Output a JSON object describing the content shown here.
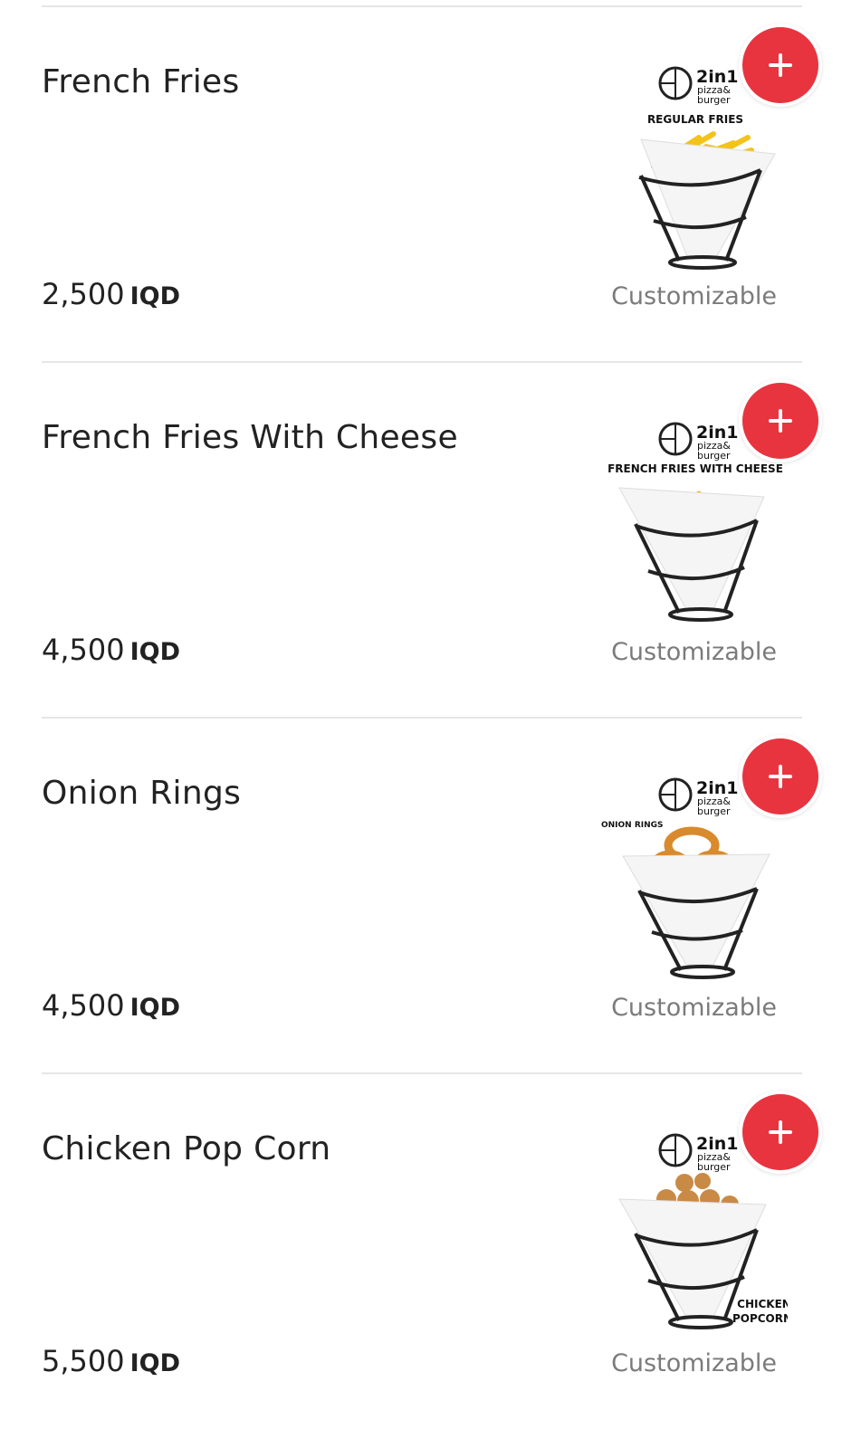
{
  "currency": "IQD",
  "customizable_label": "Customizable",
  "brand": {
    "logo_big": "2in1",
    "logo_small_1": "pizza&",
    "logo_small_2": "burger"
  },
  "accent_color": "#e8343f",
  "items": [
    {
      "name": "French Fries",
      "price": "2,500",
      "image_caption": "REGULAR FRIES",
      "image_kind": "fries"
    },
    {
      "name": "French Fries With Cheese",
      "price": "4,500",
      "image_caption": "FRENCH FRIES WITH CHEESE",
      "image_kind": "cheese-fries"
    },
    {
      "name": "Onion Rings",
      "price": "4,500",
      "image_caption": "ONION RINGS",
      "image_kind": "onion-rings"
    },
    {
      "name": "Chicken Pop Corn",
      "price": "5,500",
      "image_caption_1": "CHICKEN",
      "image_caption_2": "POPCORN",
      "image_kind": "popcorn"
    }
  ]
}
